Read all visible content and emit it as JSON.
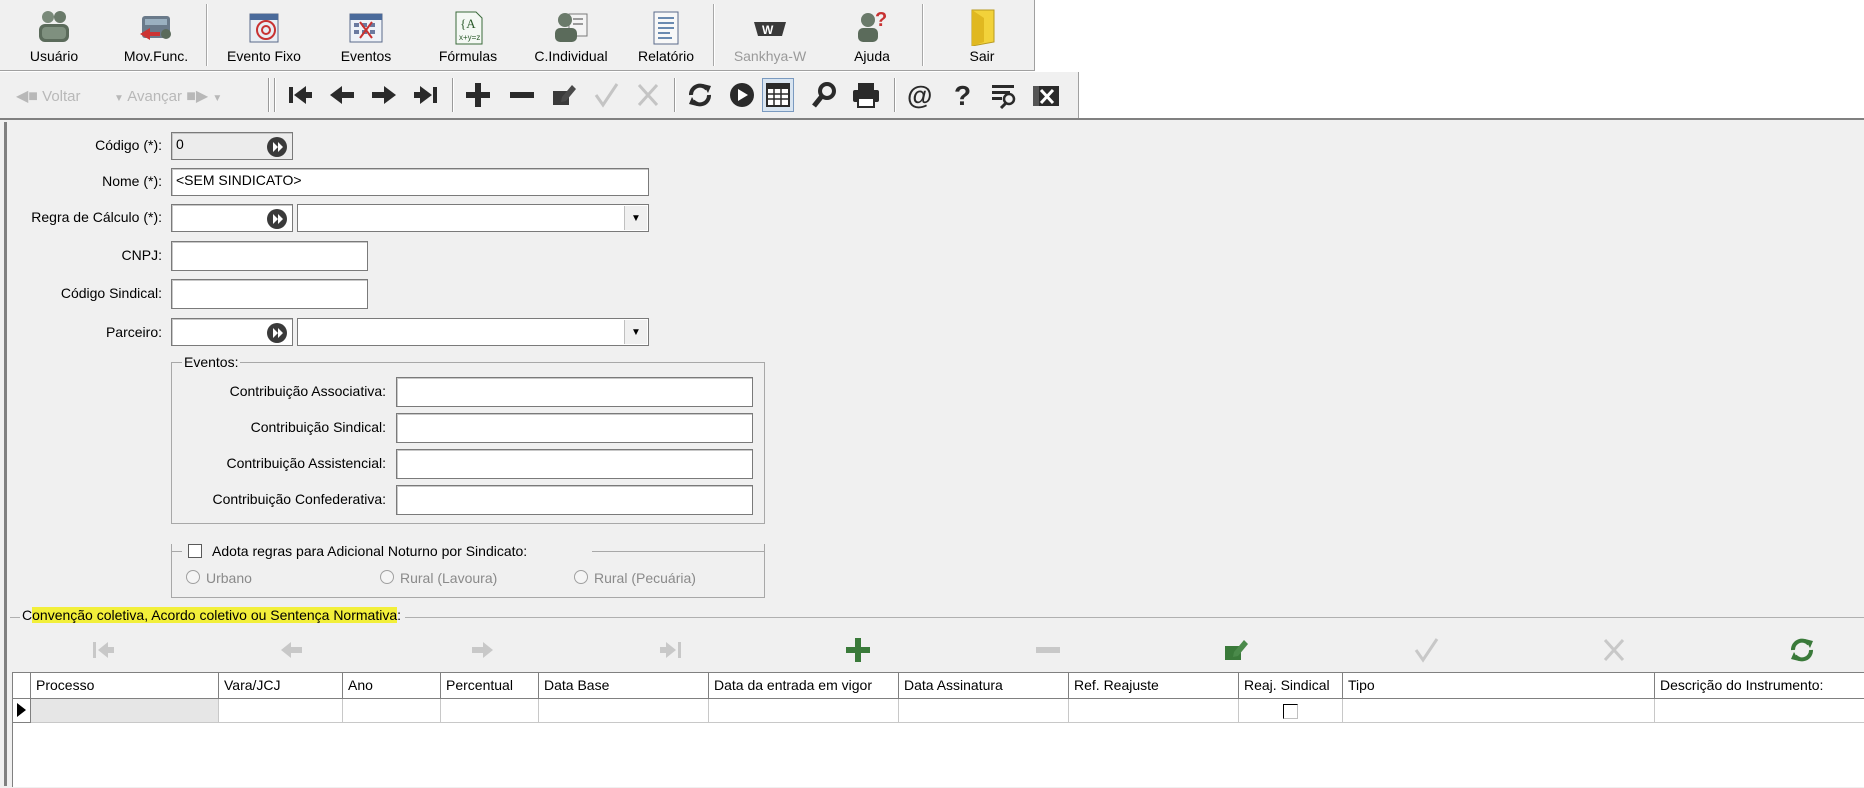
{
  "toolbar": {
    "buttons": [
      {
        "label": "Usuário",
        "icon": "users-icon"
      },
      {
        "label": "Mov.Func.",
        "icon": "movement-icon"
      },
      {
        "label": "Evento Fixo",
        "icon": "fixed-event-icon"
      },
      {
        "label": "Eventos",
        "icon": "events-icon"
      },
      {
        "label": "Fórmulas",
        "icon": "formula-icon"
      },
      {
        "label": "C.Individual",
        "icon": "individual-icon"
      },
      {
        "label": "Relatório",
        "icon": "report-icon"
      },
      {
        "label": "Sankhya-W",
        "icon": "sankhya-w-icon"
      },
      {
        "label": "Ajuda",
        "icon": "help-person-icon"
      },
      {
        "label": "Sair",
        "icon": "exit-door-icon"
      }
    ]
  },
  "navbar": {
    "back_label": "Voltar",
    "forward_label": "Avançar"
  },
  "form": {
    "codigo_label": "Código (*):",
    "codigo_value": "0",
    "nome_label": "Nome (*):",
    "nome_value": "<SEM SINDICATO>",
    "regra_label": "Regra de Cálculo (*):",
    "regra_value": "",
    "cnpj_label": "CNPJ:",
    "cnpj_value": "",
    "codsind_label": "Código Sindical:",
    "codsind_value": "",
    "parceiro_label": "Parceiro:",
    "parceiro_value": ""
  },
  "eventos": {
    "legend": "Eventos:",
    "assoc_label": "Contribuição Associativa:",
    "sind_label": "Contribuição Sindical:",
    "assist_label": "Contribuição Assistencial:",
    "confed_label": "Contribuição Confederativa:"
  },
  "noturno": {
    "legend": "Adota regras para Adicional Noturno por Sindicato:",
    "checked": false,
    "opt_urbano": "Urbano",
    "opt_lavoura": "Rural (Lavoura)",
    "opt_pecuaria": "Rural (Pecuária)"
  },
  "convencao": {
    "title_first": "C",
    "title_highlight": "onvenção coletiva, Acordo coletivo ou Sentença Normativa",
    "title_end": ":"
  },
  "grid": {
    "columns": [
      "Processo",
      "Vara/JCJ",
      "Ano",
      "Percentual",
      "Data Base",
      "Data da entrada em vigor",
      "Data Assinatura",
      "Ref. Reajuste",
      "Reaj. Sindical",
      "Tipo",
      "Descrição do Instrumento:"
    ]
  },
  "colors": {
    "toolbar_bg": "#f0f0f0",
    "highlight": "#f2ef3a",
    "green_icon": "#3a7a3a"
  }
}
